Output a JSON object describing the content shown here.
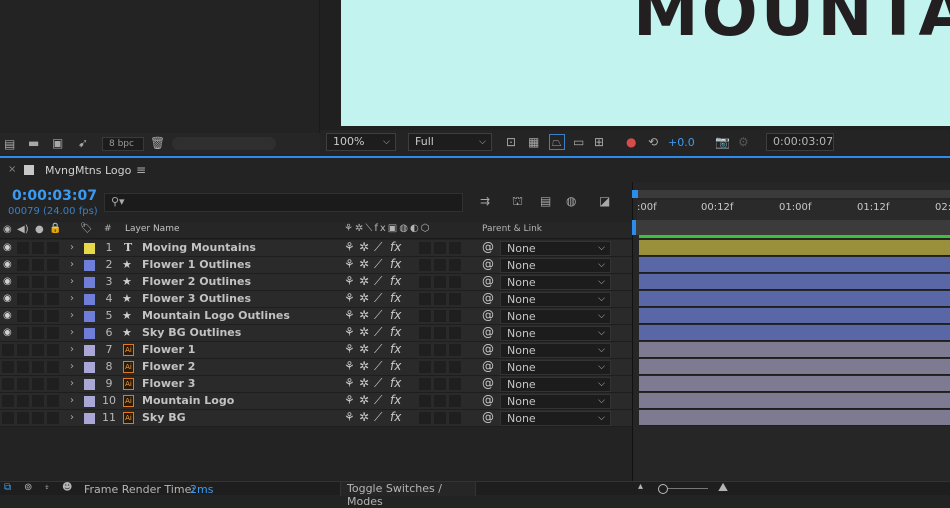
{
  "project": {
    "bpc": "8 bpc"
  },
  "viewer": {
    "canvas_text": "MOUNTA",
    "zoom": "100%",
    "resolution": "Full",
    "exposure": "+0.0",
    "timecode": "0:00:03:07"
  },
  "timeline": {
    "comp_name": "MvngMtns Logo",
    "current_time": "0:00:03:07",
    "frame_info": "00079 (24.00 fps)",
    "search_placeholder": "",
    "columns": {
      "hash": "#",
      "layer_name": "Layer Name",
      "parent_link": "Parent & Link"
    },
    "ruler_ticks": [
      ":00f",
      "00:12f",
      "01:00f",
      "01:12f",
      "02:"
    ],
    "layers": [
      {
        "num": "1",
        "name": "Moving Mountains",
        "type": "T",
        "color": "#e8d94a",
        "visible": true,
        "parent": "None",
        "bar_color": "#9a8f3a"
      },
      {
        "num": "2",
        "name": "Flower 1 Outlines",
        "type": "★",
        "color": "#6f7ed8",
        "visible": true,
        "parent": "None",
        "bar_color": "#5a67a6"
      },
      {
        "num": "3",
        "name": "Flower 2 Outlines",
        "type": "★",
        "color": "#6f7ed8",
        "visible": true,
        "parent": "None",
        "bar_color": "#5a67a6"
      },
      {
        "num": "4",
        "name": "Flower 3 Outlines",
        "type": "★",
        "color": "#6f7ed8",
        "visible": true,
        "parent": "None",
        "bar_color": "#5a67a6"
      },
      {
        "num": "5",
        "name": "Mountain Logo Outlines",
        "type": "★",
        "color": "#6f7ed8",
        "visible": true,
        "parent": "None",
        "bar_color": "#5a67a6"
      },
      {
        "num": "6",
        "name": "Sky BG Outlines",
        "type": "★",
        "color": "#6f7ed8",
        "visible": true,
        "parent": "None",
        "bar_color": "#5a67a6"
      },
      {
        "num": "7",
        "name": "Flower 1",
        "type": "ai",
        "color": "#aaa6d6",
        "visible": false,
        "parent": "None",
        "bar_color": "#7d7a91"
      },
      {
        "num": "8",
        "name": "Flower 2",
        "type": "ai",
        "color": "#aaa6d6",
        "visible": false,
        "parent": "None",
        "bar_color": "#7d7a91"
      },
      {
        "num": "9",
        "name": "Flower 3",
        "type": "ai",
        "color": "#aaa6d6",
        "visible": false,
        "parent": "None",
        "bar_color": "#7d7a91"
      },
      {
        "num": "10",
        "name": "Mountain Logo",
        "type": "ai",
        "color": "#aaa6d6",
        "visible": false,
        "parent": "None",
        "bar_color": "#7d7a91"
      },
      {
        "num": "11",
        "name": "Sky BG",
        "type": "ai",
        "color": "#aaa6d6",
        "visible": false,
        "parent": "None",
        "bar_color": "#7d7a91"
      }
    ]
  },
  "footer": {
    "render_label": "Frame Render Time:",
    "render_value": "2ms",
    "toggle_label": "Toggle Switches / Modes"
  },
  "colors": {
    "accent": "#2d8ceb",
    "canvas_bg": "#c2f3ef"
  }
}
